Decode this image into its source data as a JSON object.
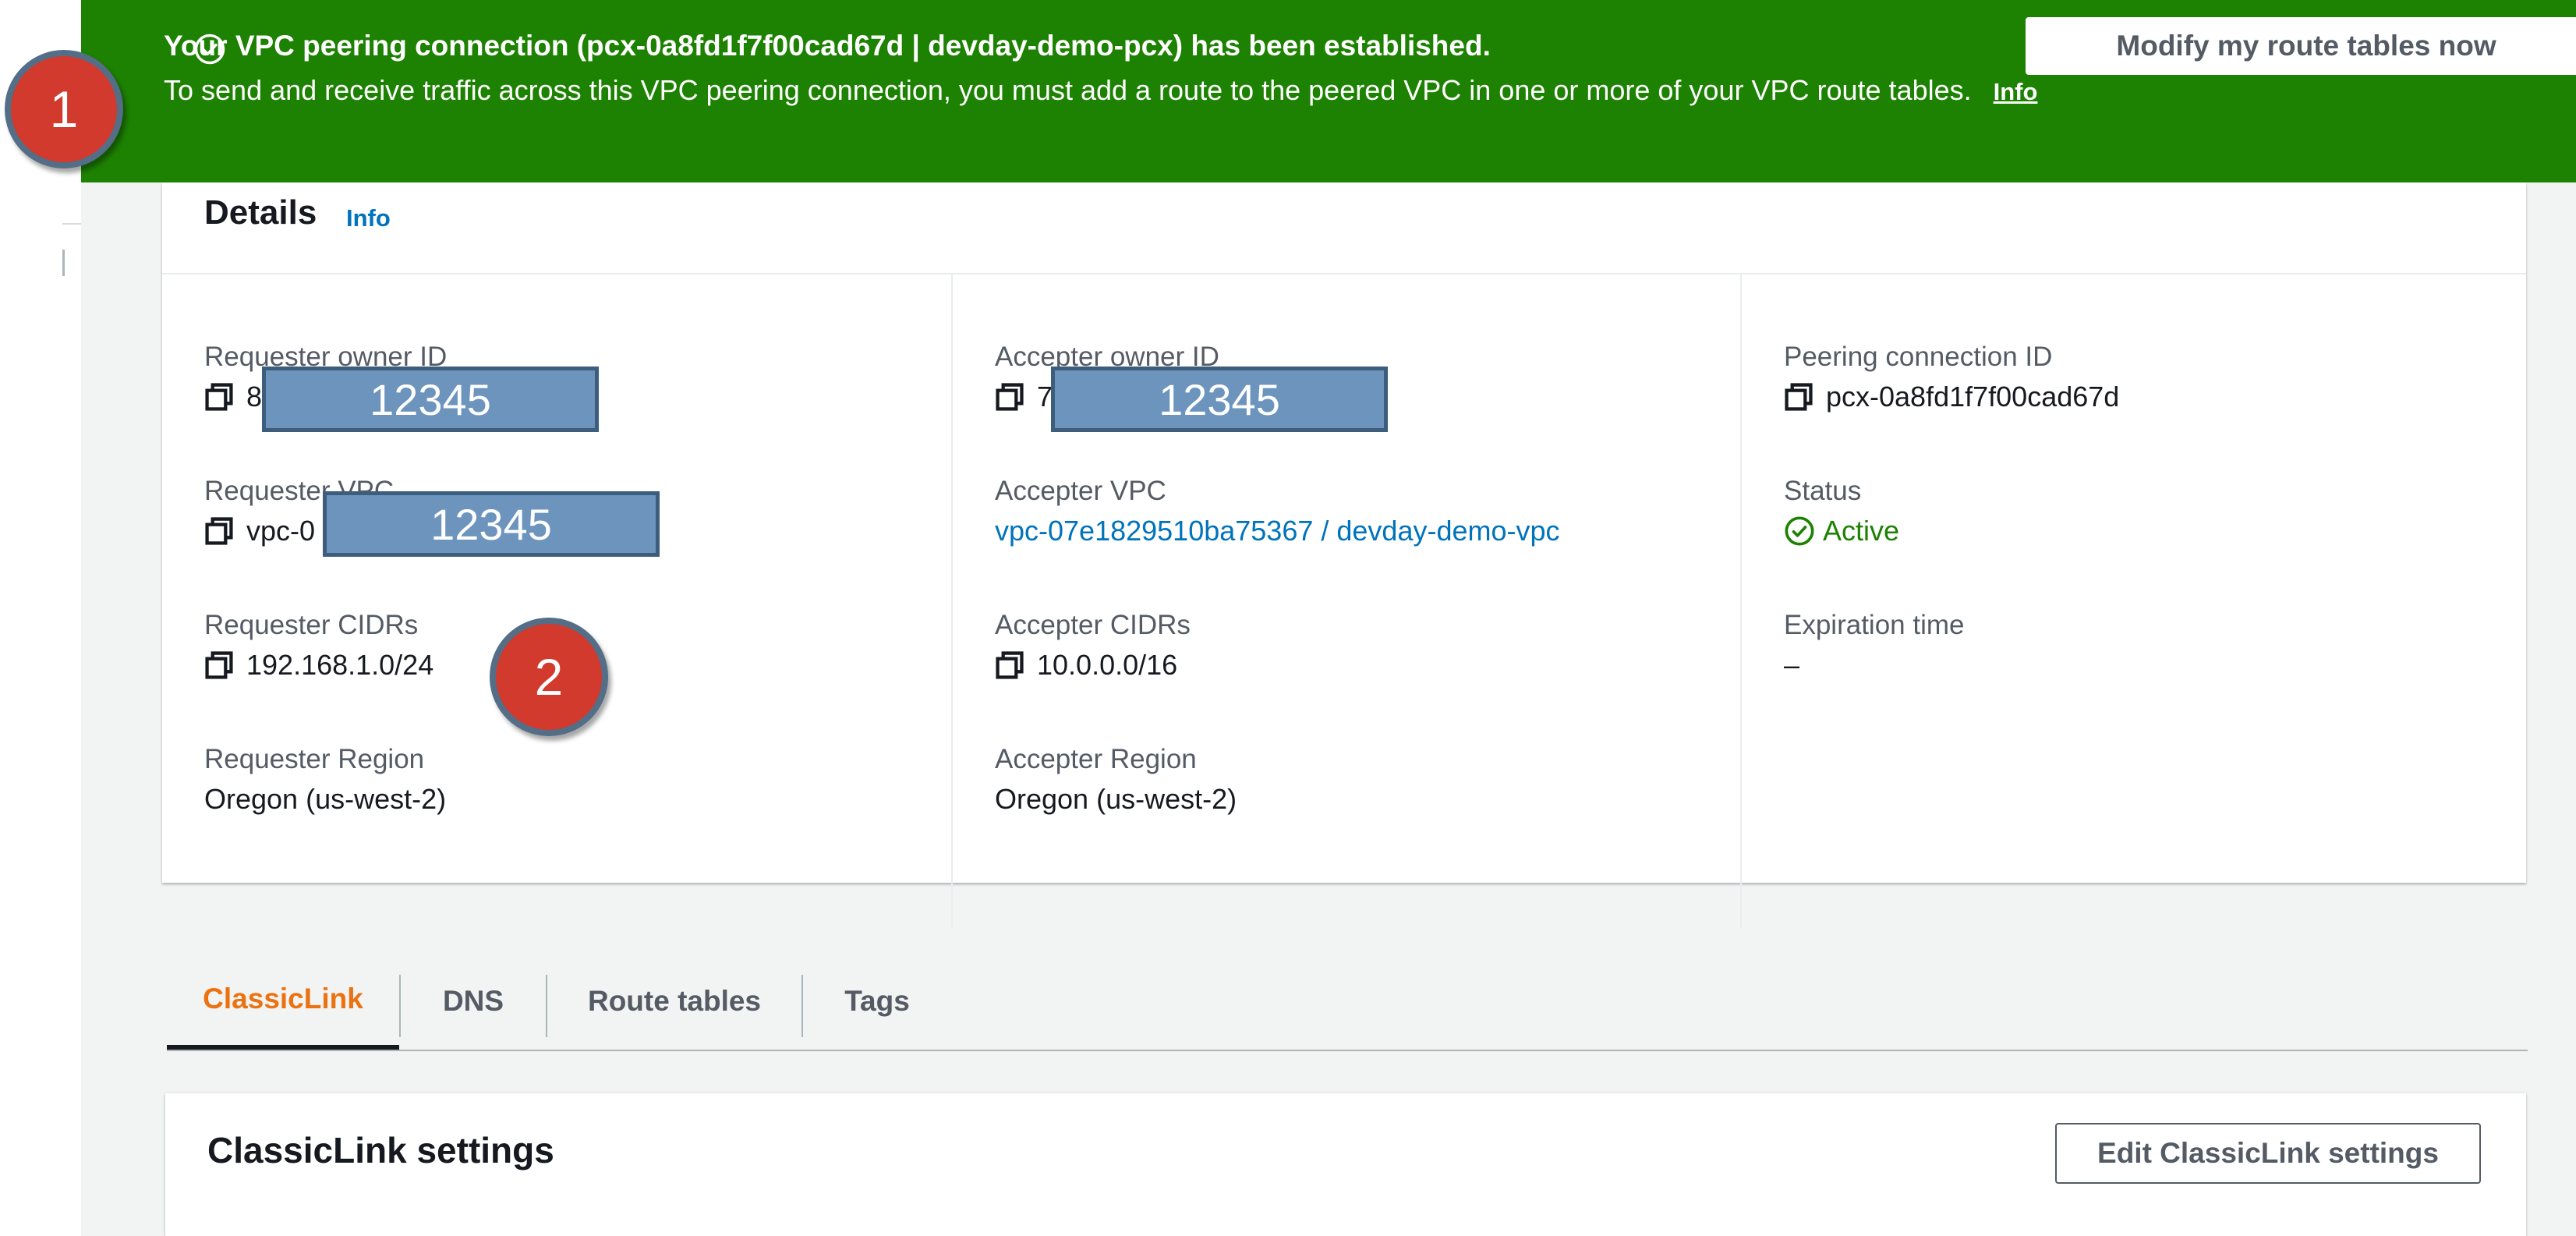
{
  "flash": {
    "title": "Your VPC peering connection (pcx-0a8fd1f7f00cad67d | devday-demo-pcx) has been established.",
    "body": "To send and receive traffic across this VPC peering connection, you must add a route to the peered VPC in one or more of your VPC route tables.",
    "info_label": "Info",
    "modify_button_label": "Modify my route tables now",
    "status_icon": "success-check-icon",
    "close_icon": "close-icon",
    "color": "#1d8102"
  },
  "details": {
    "title": "Details",
    "info_label": "Info",
    "fields": {
      "requester_owner_id": {
        "label": "Requester owner ID",
        "value_prefix": "8"
      },
      "requester_vpc": {
        "label": "Requester VPC",
        "value_prefix": "vpc-0"
      },
      "requester_cidrs": {
        "label": "Requester CIDRs",
        "value": "192.168.1.0/24"
      },
      "requester_region": {
        "label": "Requester Region",
        "value": "Oregon (us-west-2)"
      },
      "accepter_owner_id": {
        "label": "Accepter owner ID",
        "value_prefix": "7"
      },
      "accepter_vpc": {
        "label": "Accepter VPC",
        "value": "vpc-07e1829510ba75367 / devday-demo-vpc"
      },
      "accepter_cidrs": {
        "label": "Accepter CIDRs",
        "value": "10.0.0.0/16"
      },
      "accepter_region": {
        "label": "Accepter Region",
        "value": "Oregon (us-west-2)"
      },
      "peering_connection_id": {
        "label": "Peering connection ID",
        "value": "pcx-0a8fd1f7f00cad67d"
      },
      "status": {
        "label": "Status",
        "value": "Active",
        "color": "#1d8102"
      },
      "expiration_time": {
        "label": "Expiration time",
        "value": "–"
      }
    }
  },
  "redactions": {
    "requester_owner_id": "12345",
    "accepter_owner_id": "12345",
    "requester_vpc": "12345"
  },
  "markers": {
    "m1": "1",
    "m2": "2"
  },
  "tabs": [
    {
      "label": "ClassicLink",
      "active": true
    },
    {
      "label": "DNS",
      "active": false
    },
    {
      "label": "Route tables",
      "active": false
    },
    {
      "label": "Tags",
      "active": false
    }
  ],
  "classiclink": {
    "title": "ClassicLink settings",
    "edit_button_label": "Edit ClassicLink settings"
  },
  "colors": {
    "accent_orange": "#ec7211",
    "link_blue": "#0073bb",
    "success_green": "#1d8102"
  }
}
